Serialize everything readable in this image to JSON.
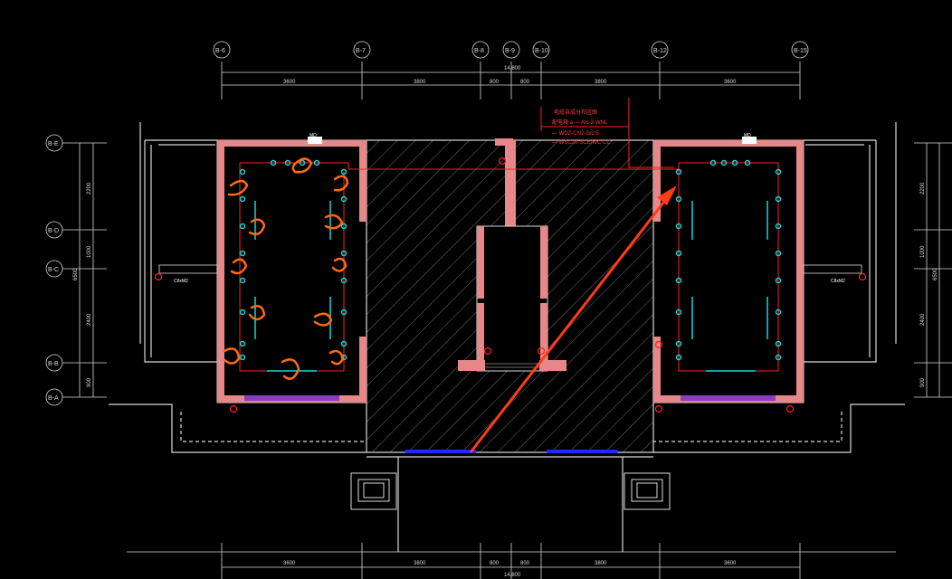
{
  "drawing": {
    "background": "#000000",
    "colors": {
      "wall": "#d9d9d9",
      "column": "#e8878a",
      "red_wire": "#ff2020",
      "cyan": "#19d6d6",
      "orange_mark": "#ff6a13",
      "arrow": "#ff3b1a",
      "blue_window": "#1c2bff",
      "magenta_door": "#c63bff"
    },
    "top_axes": [
      "B-6",
      "B-7",
      "B-8",
      "B-9",
      "B-10",
      "B-12",
      "B-15"
    ],
    "top_total": "14,800",
    "top_dims": [
      "3600",
      "3800",
      "800",
      "800",
      "3800",
      "3600"
    ],
    "left_axes": [
      "B-E",
      "B-D",
      "B-C",
      "B-B",
      "B-A"
    ],
    "left_dims": [
      "2200",
      "1000",
      "6500",
      "2400",
      "900"
    ],
    "right_dims": [
      "2200",
      "1000",
      "6500",
      "2400",
      "900"
    ],
    "bottom_dims": [
      "3600",
      "3800",
      "800",
      "800",
      "3800",
      "3600"
    ],
    "bottom_total": "14,800",
    "notes": {
      "title": "电缆自成分布区图",
      "line1": "配电箱 a — Atc-3-WNL",
      "line2": "— WDZ-CN2-3x2.5",
      "line3": "— WSC20-SCE/WC CC"
    },
    "panel_labels": {
      "left": "MD",
      "right": "MD",
      "side_left": "C8xM2",
      "side_right": "C8xM2"
    }
  }
}
